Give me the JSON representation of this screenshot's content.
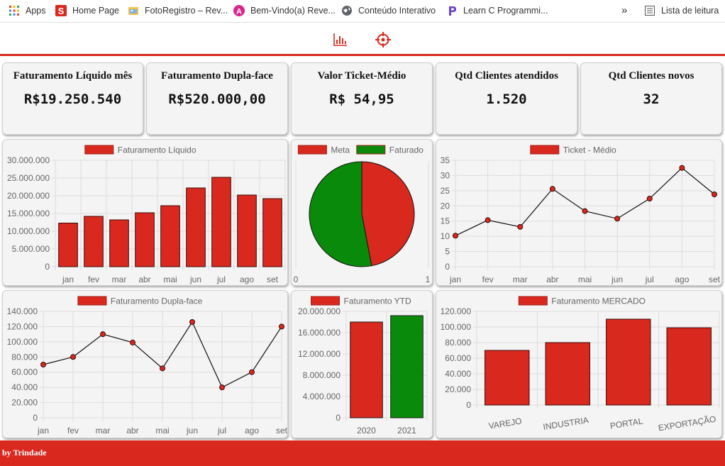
{
  "bookmarks": [
    {
      "label": "Apps",
      "icon": "apps-grid-icon"
    },
    {
      "label": "Home Page",
      "icon": "s-logo-icon"
    },
    {
      "label": "FotoRegistro – Rev...",
      "icon": "photo-folder-icon"
    },
    {
      "label": "Bem-Vindo(a) Reve...",
      "icon": "a-logo-icon"
    },
    {
      "label": "Conteúdo Interativo",
      "icon": "globe-icon"
    },
    {
      "label": "Learn C Programmi...",
      "icon": "p-logo-icon"
    }
  ],
  "bookmarks_more": "»",
  "reading_list": "Lista de leitura",
  "toolbar": {
    "chart_icon": "bar-chart-icon",
    "target_icon": "crosshair-icon",
    "accent": "#d9281e"
  },
  "kpis": [
    {
      "title": "Faturamento Líquido mês",
      "value": "R$19.250.540"
    },
    {
      "title": "Faturamento Dupla-face",
      "value": "R$520.000,00"
    },
    {
      "title": "Valor Ticket-Médio",
      "value": "R$ 54,95"
    },
    {
      "title": "Qtd Clientes atendidos",
      "value": "1.520"
    },
    {
      "title": "Qtd Clientes novos",
      "value": "32"
    }
  ],
  "footer": "by Trindade",
  "colors": {
    "red": "#d9281e",
    "green": "#0a8a0a",
    "grid": "#dddddd",
    "text": "#666666"
  },
  "chart_data": [
    {
      "type": "bar",
      "legend": "Faturamento Líquido",
      "categories": [
        "jan",
        "fev",
        "mar",
        "abr",
        "mai",
        "jun",
        "jul",
        "ago",
        "set"
      ],
      "values": [
        12300000,
        14200000,
        13200000,
        15200000,
        17200000,
        22200000,
        25200000,
        20200000,
        19200000
      ],
      "ylim": [
        0,
        30000000
      ],
      "yticks": [
        "30.000.000",
        "25.000.000",
        "20.000.000",
        "15.000.000",
        "10.000.000",
        "5.000.000",
        "0"
      ]
    },
    {
      "type": "pie",
      "legend": [
        "Meta",
        "Faturado"
      ],
      "values": [
        47,
        53
      ],
      "xticks": [
        "0",
        "1"
      ]
    },
    {
      "type": "line",
      "legend": "Ticket - Médio",
      "categories": [
        "jan",
        "fev",
        "mar",
        "abr",
        "mai",
        "jun",
        "jul",
        "ago",
        "set"
      ],
      "values": [
        10.2,
        15.3,
        13.1,
        25.6,
        18.3,
        15.8,
        22.4,
        32.5,
        23.8
      ],
      "ylim": [
        0,
        35
      ],
      "yticks": [
        "35",
        "30",
        "25",
        "20",
        "15",
        "10",
        "5",
        "0"
      ]
    },
    {
      "type": "line",
      "legend": "Faturamento Dupla-face",
      "categories": [
        "jan",
        "fev",
        "mar",
        "abr",
        "mai",
        "jun",
        "jul",
        "ago",
        "set"
      ],
      "values": [
        70000,
        80000,
        110000,
        99000,
        65000,
        126000,
        40000,
        60000,
        120000
      ],
      "ylim": [
        0,
        140000
      ],
      "yticks": [
        "140.000",
        "120.000",
        "100.000",
        "80.000",
        "60.000",
        "40.000",
        "20.000",
        "0"
      ]
    },
    {
      "type": "bar",
      "legend": "Faturamento YTD",
      "categories": [
        "2020",
        "2021"
      ],
      "values": [
        18000000,
        19200000
      ],
      "ylim": [
        0,
        20000000
      ],
      "yticks": [
        "20.000.000",
        "16.000.000",
        "12.000.000",
        "8.000.000",
        "4.000.000",
        "0"
      ]
    },
    {
      "type": "bar",
      "legend": "Faturamento MERCADO",
      "categories": [
        "VAREJO",
        "INDUSTRIA",
        "PORTAL",
        "EXPORTAÇÃO"
      ],
      "values": [
        70000,
        80000,
        110000,
        99000
      ],
      "ylim": [
        0,
        120000
      ],
      "yticks": [
        "120.000",
        "100.000",
        "80.000",
        "60.000",
        "40.000",
        "20.000",
        "0"
      ]
    }
  ]
}
